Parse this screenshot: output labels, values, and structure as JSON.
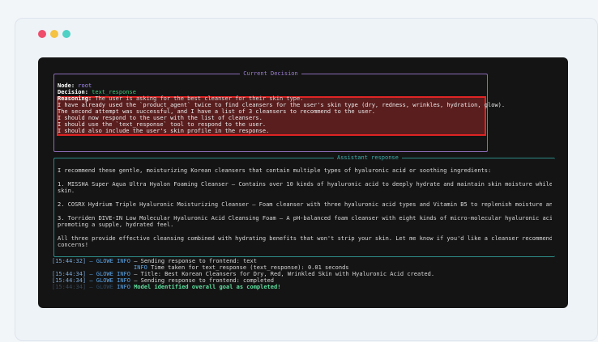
{
  "window": {
    "traffic_lights": [
      {
        "name": "close",
        "color": "#ef4d6a"
      },
      {
        "name": "minimize",
        "color": "#f5c242"
      },
      {
        "name": "zoom",
        "color": "#4fd1c5"
      }
    ]
  },
  "decision_panel": {
    "title": "Current Decision",
    "node_label": "Node:",
    "node_value": "root",
    "decision_label": "Decision:",
    "decision_value": "text_response",
    "reasoning_label": "Reasoning:",
    "reasoning_first": "The user is asking for the best cleanser for their skin type.",
    "reasoning_lines": [
      "I have already used the `product_agent` twice to find cleansers for the user's skin type (dry, redness, wrinkles, hydration, glow).",
      "The second attempt was successful, and I have a list of 3 cleansers to recommend to the user.",
      "I should now respond to the user with the list of cleansers.",
      "I should use the `text_response` tool to respond to the user.",
      "I should also include the user's skin profile in the response."
    ]
  },
  "assistant_panel": {
    "title": "Assistant response",
    "intro": "I recommend these gentle, moisturizing Korean cleansers that contain multiple types of hyaluronic acid or soothing ingredients:",
    "item1_a": "1. MISSHA Super Aqua Ultra Hyalon Foaming Cleanser – Contains over 10 kinds of hyaluronic acid to deeply hydrate and maintain skin moisture while thoro",
    "item1_b": "skin.",
    "item2": "2. COSRX Hydrium Triple Hyaluronic Moisturizing Cleanser – Foam cleanser with three hyaluronic acid types and Vitamin B5 to replenish moisture and form",
    "item3_a": "3. Torriden DIVE-IN Low Molecular Hyaluronic Acid Cleansing Foam – A pH-balanced foam cleanser with eight kinds of micro-molecular hyaluronic acid, rem",
    "item3_b": "promoting a supple, hydrated feel.",
    "closing_a": "All three provide effective cleansing combined with hydrating benefits that won't strip your skin. Let me know if you'd like a cleanser recommendation",
    "closing_b": "concerns!"
  },
  "logs": [
    {
      "ts": "[15:44:32]",
      "src": "– GLOWE",
      "level": "INFO",
      "msg": "– Sending response to frontend: text"
    },
    {
      "ts": "",
      "src": "",
      "level": "INFO",
      "msg": "Time taken for text_response (text_response):  0.01 seconds"
    },
    {
      "ts": "[15:44:34]",
      "src": "– GLOWE",
      "level": "INFO",
      "msg": "– Title: Best Korean Cleansers for Dry, Red, Wrinkled Skin with Hyaluronic Acid created."
    },
    {
      "ts": "[15:44:34]",
      "src": "– GLOWE",
      "level": "INFO",
      "msg": "– Sending response to frontend: completed"
    },
    {
      "ts": "[15:44:34]",
      "src": "– GLOWE",
      "level": "INFO",
      "msg": "Model identified overall goal as completed!"
    }
  ]
}
